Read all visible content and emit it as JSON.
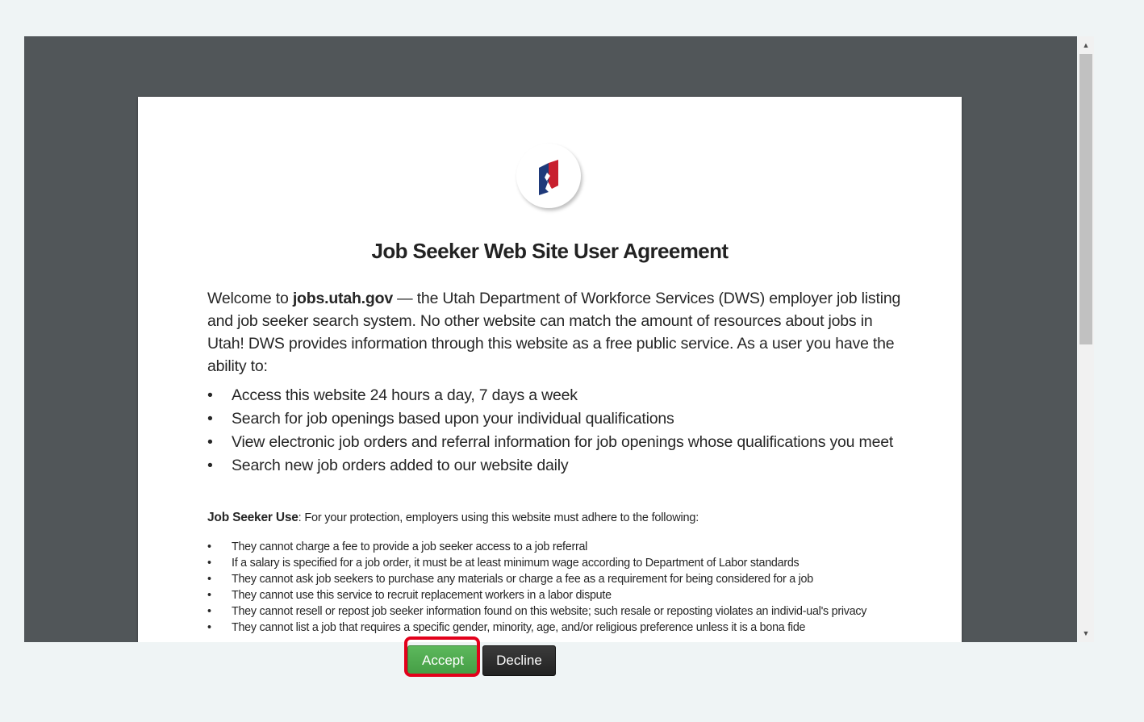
{
  "document": {
    "title": "Job Seeker Web Site User Agreement",
    "intro": {
      "before": "Welcome to ",
      "site": "jobs.utah.gov",
      "after": " — the Utah Department of Workforce Services (DWS) employer job listing and job seeker search system. No other website can match the amount of resources about jobs in Utah! DWS provides information through this website as a free public service. As a user you have the ability to:"
    },
    "abilities": [
      "Access this website 24 hours a day, 7 days a week",
      "Search for job openings based upon your individual qualifications",
      "View electronic job orders and referral information for job openings whose qualifications you meet",
      "Search new job orders added to our website daily"
    ],
    "job_seeker_use": {
      "heading": "Job Seeker Use",
      "text": ": For your protection, employers using this website must adhere to the following:"
    },
    "employer_rules": [
      "They cannot charge a fee to provide a job seeker access to a job referral",
      "If a salary is specified for a job order, it must be at least minimum wage according to Department of Labor standards",
      "They cannot ask job seekers to purchase any materials or charge a fee as a requirement for being considered for a job",
      "They cannot use this service to recruit replacement workers in a labor dispute",
      "They cannot resell or repost job seeker information found on this website; such resale or reposting violates an individ-ual's privacy",
      "They cannot list a job that requires a specific gender, minority, age, and/or religious preference unless it is a bona fide"
    ]
  },
  "actions": {
    "accept_label": "Accept",
    "decline_label": "Decline"
  },
  "colors": {
    "accept": "#4cae4c",
    "decline": "#2b2b2b",
    "highlight": "#e3001b",
    "viewer_bg": "#515659",
    "logo_blue": "#1f3a7a",
    "logo_red": "#c8202f"
  },
  "icons": {
    "logo": "dws-logo-icon",
    "scroll_up": "scroll-up-arrow-icon",
    "scroll_down": "scroll-down-arrow-icon"
  }
}
